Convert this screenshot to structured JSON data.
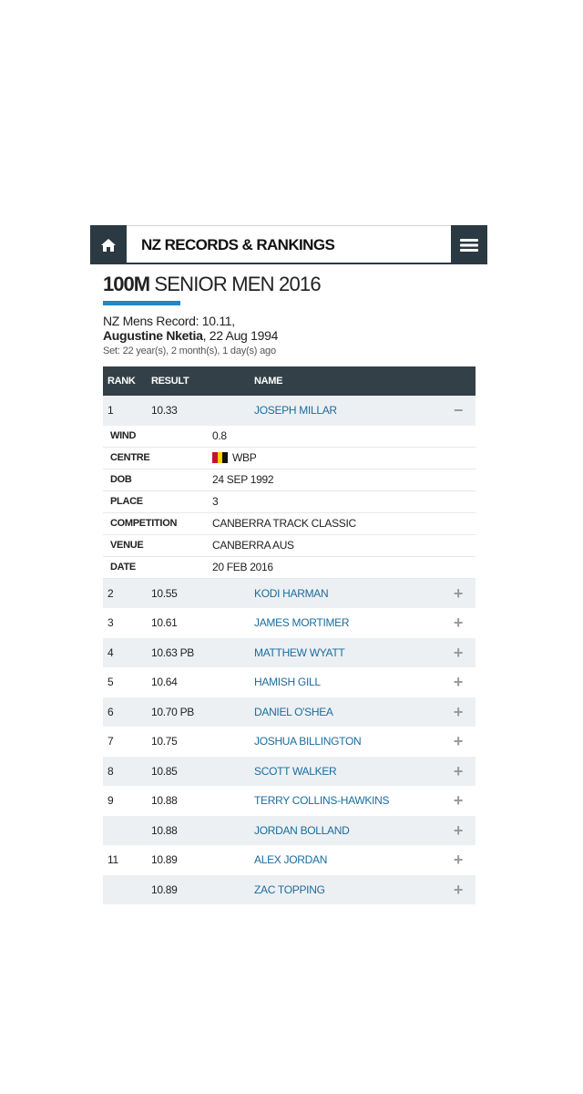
{
  "header": {
    "brand": "NZ RECORDS & RANKINGS",
    "home_icon": "home-icon",
    "menu_icon": "hamburger-menu-icon"
  },
  "page": {
    "title_bold": "100M",
    "title_rest": " SENIOR MEN 2016",
    "record_line": "NZ Mens Record: 10.11,",
    "record_holder": "Augustine Nketia",
    "record_date": ", 22 Aug 1994",
    "record_set": "Set: 22 year(s), 2 month(s), 1 day(s) ago"
  },
  "table": {
    "headers": {
      "rank": "RANK",
      "result": "RESULT",
      "name": "NAME"
    },
    "expanded_row": {
      "rank": "1",
      "result": "10.33",
      "name": "JOSEPH MILLAR",
      "toggle": "−"
    },
    "details": [
      {
        "label": "WIND",
        "value": "0.8"
      },
      {
        "label": "CENTRE",
        "value": "WBP",
        "flag": [
          "#c8102e",
          "#ffd100",
          "#111111"
        ]
      },
      {
        "label": "DOB",
        "value": "24 SEP 1992"
      },
      {
        "label": "PLACE",
        "value": "3"
      },
      {
        "label": "COMPETITION",
        "value": "CANBERRA TRACK CLASSIC"
      },
      {
        "label": "VENUE",
        "value": "CANBERRA AUS"
      },
      {
        "label": "DATE",
        "value": "20 FEB 2016"
      }
    ],
    "rows": [
      {
        "rank": "2",
        "result": "10.55",
        "name": "KODI HARMAN",
        "toggle": "+"
      },
      {
        "rank": "3",
        "result": "10.61",
        "name": "JAMES MORTIMER",
        "toggle": "+"
      },
      {
        "rank": "4",
        "result": "10.63 PB",
        "name": "MATTHEW WYATT",
        "toggle": "+"
      },
      {
        "rank": "5",
        "result": "10.64",
        "name": "HAMISH GILL",
        "toggle": "+"
      },
      {
        "rank": "6",
        "result": "10.70 PB",
        "name": "DANIEL O'SHEA",
        "toggle": "+"
      },
      {
        "rank": "7",
        "result": "10.75",
        "name": "JOSHUA BILLINGTON",
        "toggle": "+"
      },
      {
        "rank": "8",
        "result": "10.85",
        "name": "SCOTT WALKER",
        "toggle": "+"
      },
      {
        "rank": "9",
        "result": "10.88",
        "name": "TERRY COLLINS-HAWKINS",
        "toggle": "+"
      },
      {
        "rank": "",
        "result": "10.88",
        "name": "JORDAN BOLLAND",
        "toggle": "+"
      },
      {
        "rank": "11",
        "result": "10.89",
        "name": "ALEX JORDAN",
        "toggle": "+"
      },
      {
        "rank": "",
        "result": "10.89",
        "name": "ZAC TOPPING",
        "toggle": "+"
      }
    ]
  },
  "colors": {
    "header_dark": "#2b3a42",
    "table_header": "#334047",
    "accent_blue": "#1e88c8",
    "link_blue": "#1a6c9e",
    "row_shade": "#edf0f3"
  }
}
